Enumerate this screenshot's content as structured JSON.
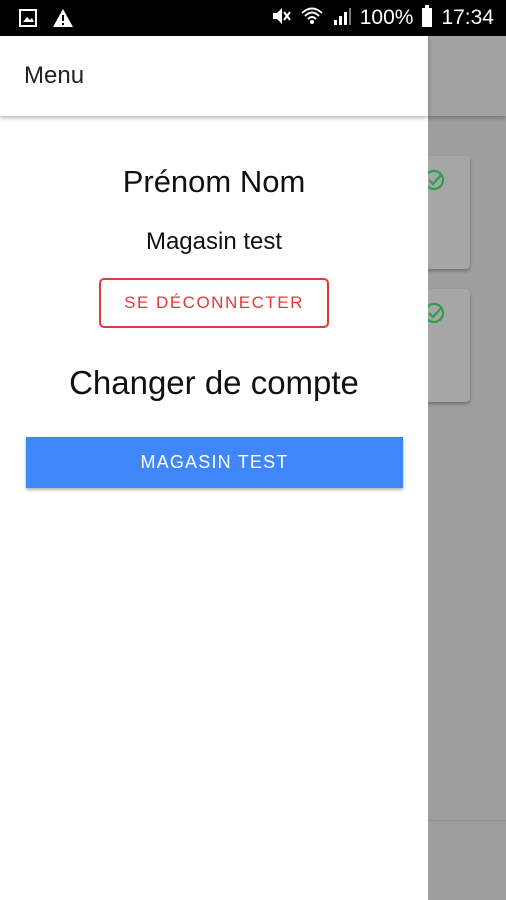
{
  "status_bar": {
    "battery_percent": "100%",
    "time": "17:34",
    "icons": [
      "image-icon",
      "warning-icon",
      "mute-icon",
      "wifi-icon",
      "signal-icon",
      "battery-icon"
    ]
  },
  "drawer": {
    "title": "Menu",
    "user_name": "Prénom Nom",
    "store_name": "Magasin test",
    "logout_label": "SE DÉCONNECTER",
    "switch_account_title": "Changer de compte",
    "accounts": [
      "MAGASIN TEST"
    ]
  },
  "background": {
    "cards": [
      {
        "icon": "check-circle-icon"
      },
      {
        "icon": "check-circle-icon"
      }
    ]
  },
  "colors": {
    "accent": "#3f86f9",
    "logout": "#e53935",
    "check": "#2e9e4a"
  }
}
